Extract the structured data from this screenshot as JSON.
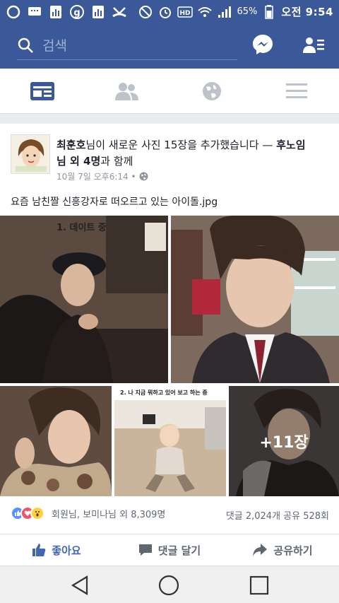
{
  "status": {
    "battery": "65%",
    "time": "오전 9:54"
  },
  "topbar": {
    "search_placeholder": "검색"
  },
  "post": {
    "author": "최훈호",
    "action_text": "님이 새로운 사진 15장을 추가했습니다 — ",
    "tagged": "후노임",
    "tagged_suffix": "님 외 4명",
    "with": "과 함께",
    "time": "10월 7일 오후6:14 •",
    "caption": "요즘 남친짤 신흥강자로 떠오르고 있는 아이돌.jpg",
    "photo1_label": "1. 데이트 중",
    "photo4_label": "2. 나 지금 뭐하고 있어 보고 하는 중",
    "more_photos": "+11장",
    "reactions_text": "회원님, 보미나님 외 8,309명",
    "comments_shares": "댓글 2,024개 공유 528회"
  },
  "actions": {
    "like": "좋아요",
    "comment": "댓글 달기",
    "share": "공유하기"
  },
  "colors": {
    "brand": "#3b5998",
    "like_blue": "#4267b2"
  }
}
